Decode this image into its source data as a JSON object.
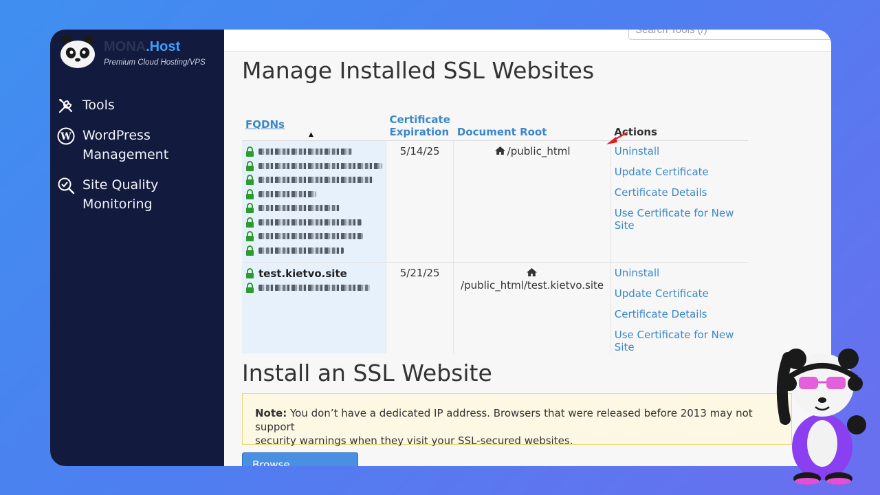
{
  "brand": {
    "name_part1": "MONA",
    "name_part2": ".Host",
    "tagline": "Premium Cloud Hosting/VPS"
  },
  "sidebar": {
    "items": [
      {
        "label": "Tools",
        "icon": "tools-icon"
      },
      {
        "label": "WordPress Management",
        "icon": "wordpress-icon"
      },
      {
        "label": "Site Quality Monitoring",
        "icon": "site-quality-icon"
      }
    ]
  },
  "search": {
    "placeholder": "Search Tools (/)"
  },
  "page": {
    "title": "Manage Installed SSL Websites",
    "install_title": "Install an SSL Website"
  },
  "table": {
    "headers": {
      "fqdns": "FQDNs",
      "expiration": "Certificate Expiration",
      "docroot": "Document Root",
      "actions": "Actions"
    },
    "sort_indicator": "▲",
    "rows": [
      {
        "expiration": "5/14/25",
        "docroot": "/public_html",
        "actions": [
          "Uninstall",
          "Update Certificate",
          "Certificate Details",
          "Use Certificate for New Site"
        ]
      },
      {
        "fqdn_visible": "test.kietvo.site",
        "expiration": "5/21/25",
        "docroot": "/public_html/test.kietvo.site",
        "actions": [
          "Uninstall",
          "Update Certificate",
          "Certificate Details",
          "Use Certificate for New Site"
        ]
      }
    ]
  },
  "note": {
    "label": "Note:",
    "text": "You don’t have a dedicated IP address. Browsers that were released before 2013 may not support",
    "text2": "security warnings when they visit your SSL-secured websites."
  },
  "browse_button": "Browse Certificates",
  "colors": {
    "sidebar_bg": "#121a3d",
    "link": "#3b87c8",
    "note_bg": "#fcf8e3",
    "lock": "#2e9b2e",
    "annotation_arrow": "#e02020"
  }
}
